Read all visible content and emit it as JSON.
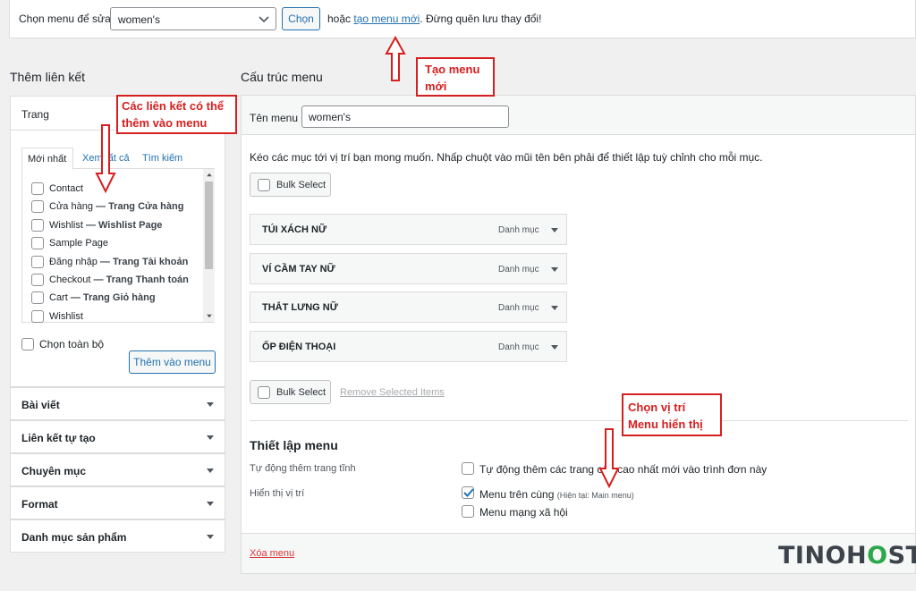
{
  "topbar": {
    "label": "Chọn menu để sửa:",
    "selected_menu": "women's",
    "select_button": "Chọn",
    "or_text": "hoặc",
    "create_link": "tạo menu mới",
    "save_hint": ". Đừng quên lưu thay đổi!"
  },
  "left": {
    "title": "Thêm liên kết",
    "pages_panel": {
      "title": "Trang",
      "tabs": [
        "Mới nhất",
        "Xem tất cả",
        "Tìm kiếm"
      ],
      "items": [
        {
          "name": "Contact",
          "suffix": ""
        },
        {
          "name": "Cửa hàng",
          "suffix": " — Trang Cửa hàng"
        },
        {
          "name": "Wishlist",
          "suffix": " — Wishlist Page"
        },
        {
          "name": "Sample Page",
          "suffix": ""
        },
        {
          "name": "Đăng nhập",
          "suffix": " — Trang Tài khoản"
        },
        {
          "name": "Checkout",
          "suffix": " — Trang Thanh toán"
        },
        {
          "name": "Cart",
          "suffix": " — Trang Giỏ hàng"
        },
        {
          "name": "Wishlist",
          "suffix": ""
        }
      ],
      "select_all": "Chọn toàn bộ",
      "add_button": "Thêm vào menu"
    },
    "sections": [
      "Bài viết",
      "Liên kết tự tạo",
      "Chuyên mục",
      "Format",
      "Danh mục sản phẩm"
    ]
  },
  "right": {
    "title": "Cấu trúc menu",
    "name_label": "Tên menu",
    "name_value": "women's",
    "instructions": "Kéo các mục tới vị trí bạn mong muốn. Nhấp chuột vào mũi tên bên phải để thiết lập tuỳ chỉnh cho mỗi mục.",
    "bulk_select": "Bulk Select",
    "remove_selected": "Remove Selected Items",
    "menu_items": [
      {
        "title": "TÚI XÁCH NỮ",
        "type": "Danh mục"
      },
      {
        "title": "VÍ CẦM TAY NỮ",
        "type": "Danh mục"
      },
      {
        "title": "THẮT LƯNG NỮ",
        "type": "Danh mục"
      },
      {
        "title": "ỐP ĐIỆN THOẠI",
        "type": "Danh mục"
      }
    ],
    "settings": {
      "title": "Thiết lập menu",
      "auto_add_label": "Tự động thêm trang tĩnh",
      "auto_add_option": "Tự động thêm các trang cấp cao nhất mới vào trình đơn này",
      "location_label": "Hiển thị vị trí",
      "loc1": "Menu trên cùng",
      "loc1_note": "(Hiện tại: Main menu)",
      "loc2": "Menu mạng xã hội"
    },
    "delete_link": "Xóa menu"
  },
  "annotations": {
    "create_new": [
      "Tạo menu",
      "mới"
    ],
    "links_addable": [
      "Các liên kết có thể",
      "thêm vào menu"
    ],
    "choose_location": [
      "Chọn vị trí",
      "Menu hiển thị"
    ]
  },
  "logo": {
    "text_a": "TINO",
    "text_b": "H",
    "text_c": "ST"
  },
  "colors": {
    "accent": "#2271b1",
    "annotation": "#d61f1f"
  }
}
